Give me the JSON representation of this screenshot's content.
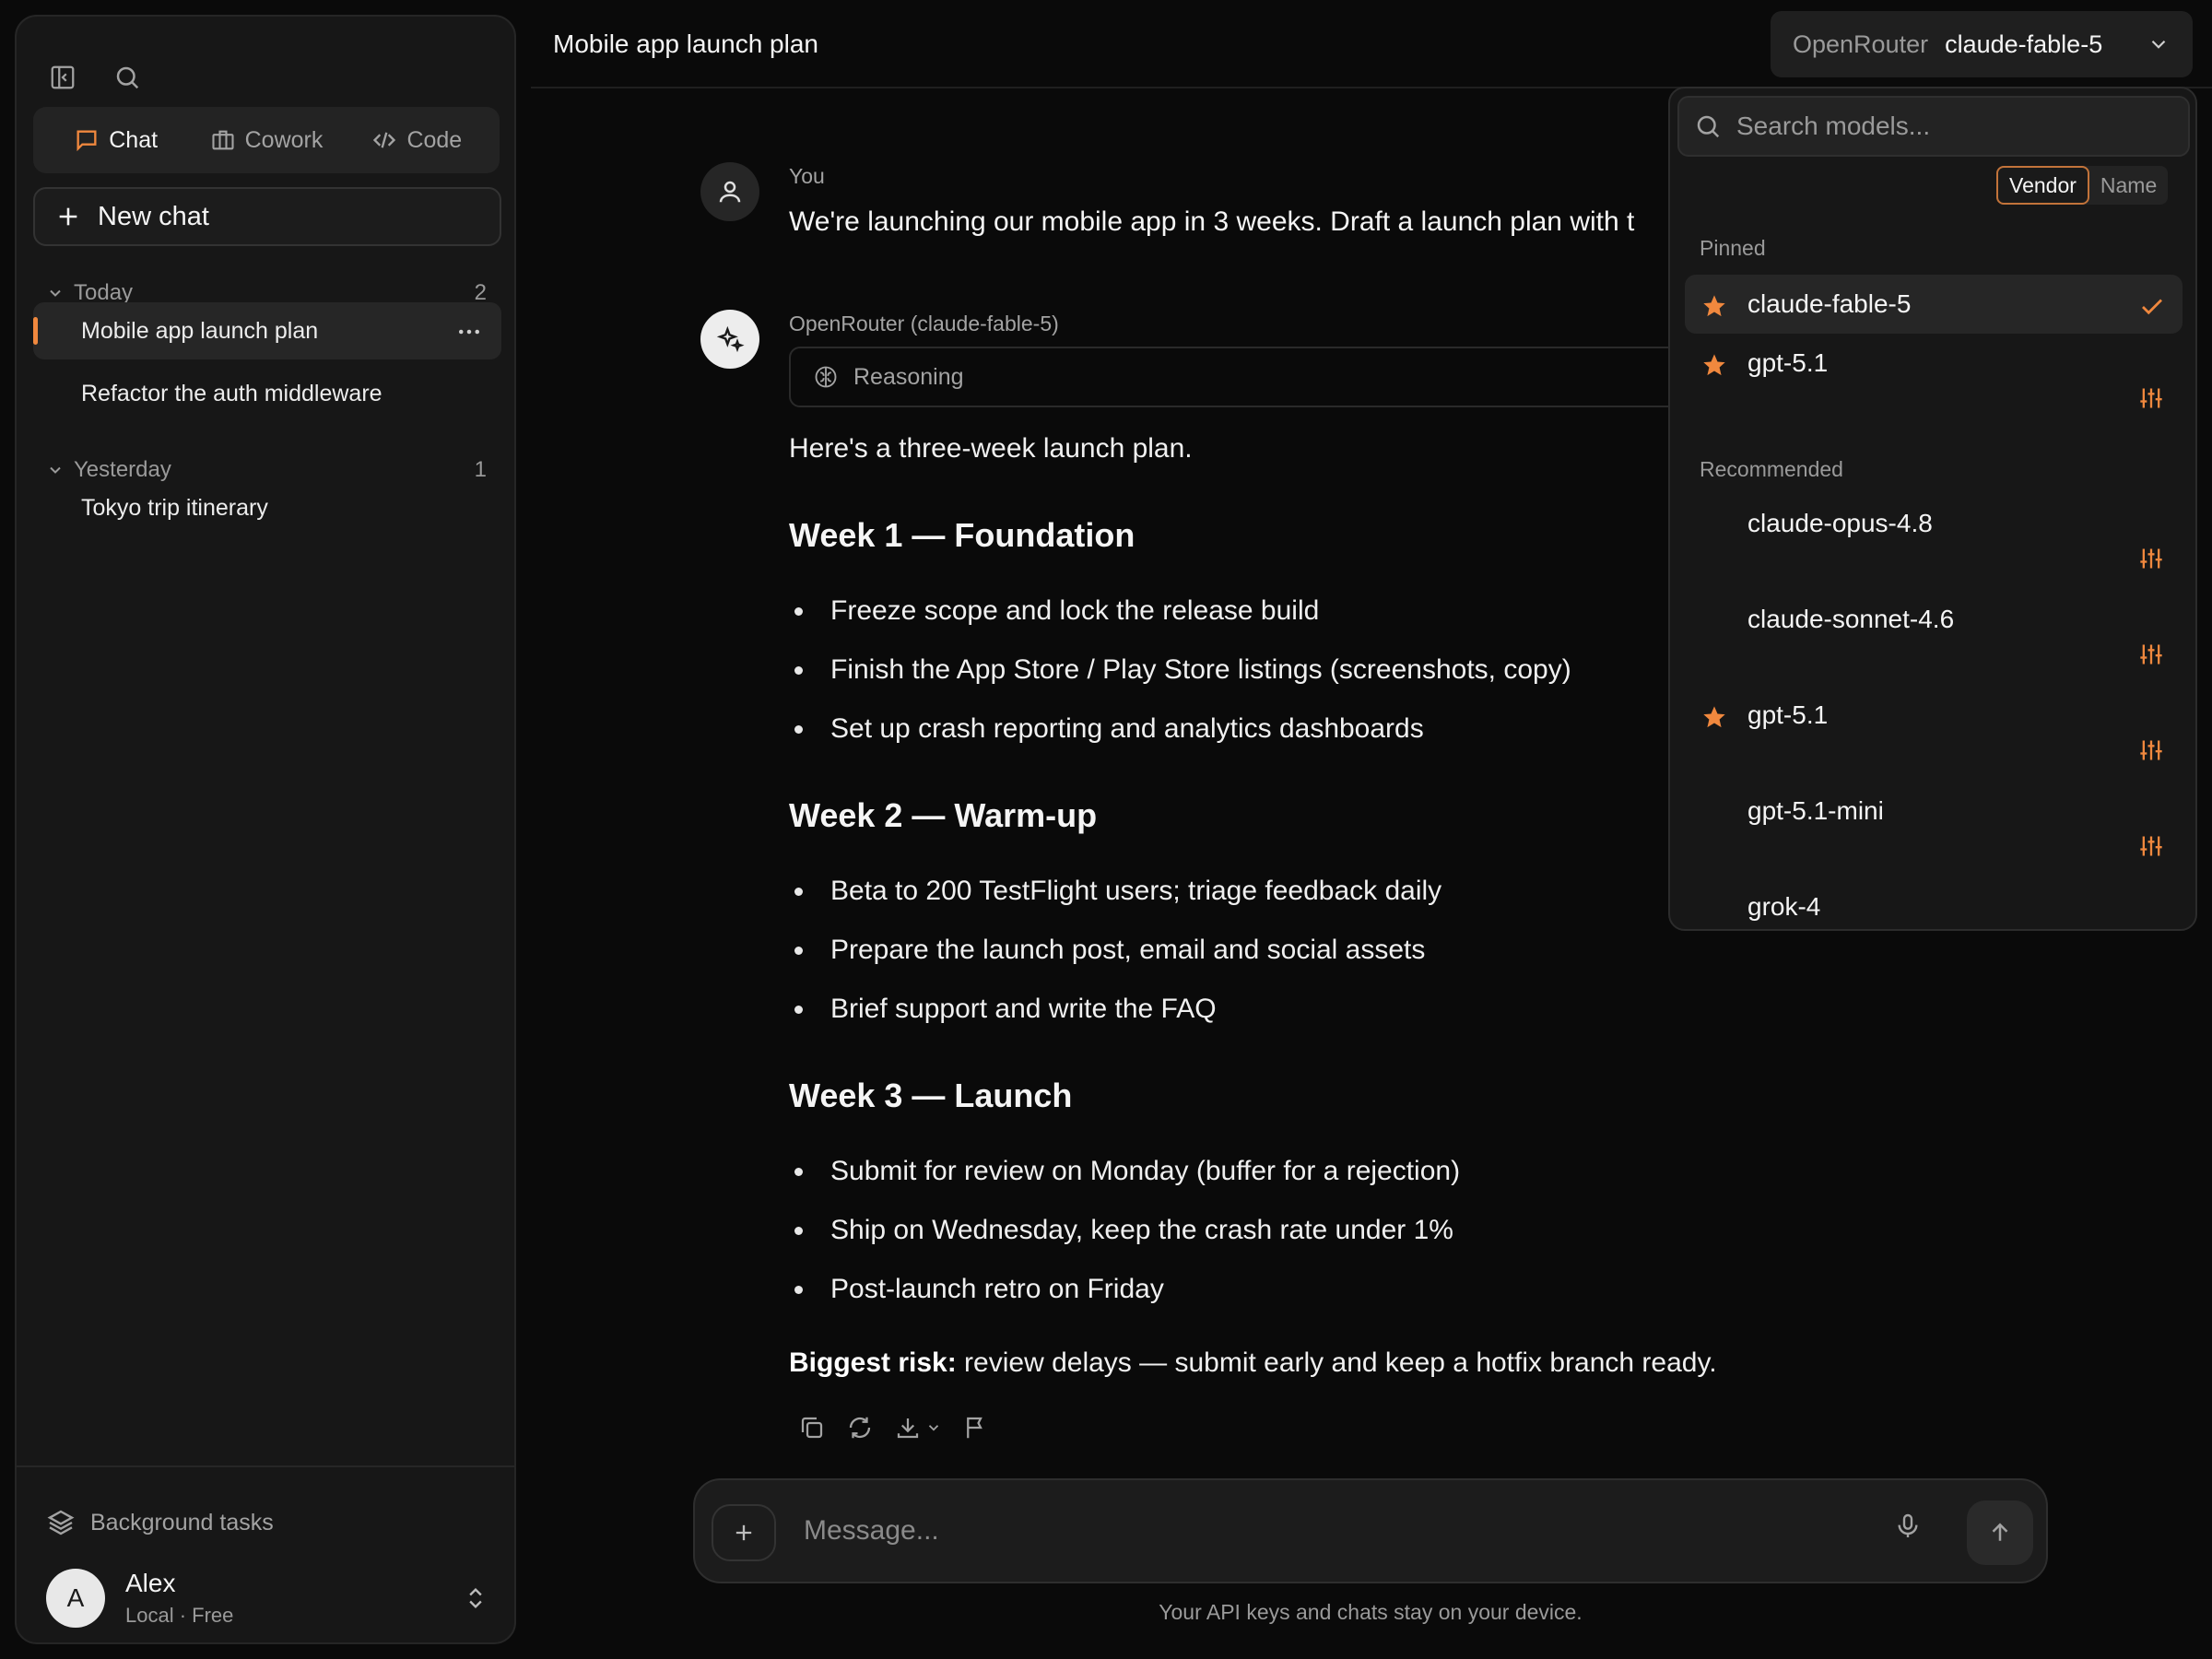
{
  "sidebar": {
    "modes": [
      "Chat",
      "Cowork",
      "Code"
    ],
    "new_chat": "New chat",
    "groups": [
      {
        "label": "Today",
        "count": "2",
        "items": [
          "Mobile app launch plan",
          "Refactor the auth middleware"
        ]
      },
      {
        "label": "Yesterday",
        "count": "1",
        "items": [
          "Tokyo trip itinerary"
        ]
      }
    ],
    "background_tasks": "Background tasks",
    "user": {
      "initial": "A",
      "name": "Alex",
      "plan": "Local · Free"
    }
  },
  "header": {
    "title": "Mobile app launch plan",
    "vendor": "OpenRouter",
    "model": "claude-fable-5"
  },
  "conversation": {
    "user_label": "You",
    "user_message": "We're launching our mobile app in 3 weeks. Draft a launch plan with t",
    "assistant_label": "OpenRouter (claude-fable-5)",
    "reasoning_label": "Reasoning",
    "intro": "Here's a three-week launch plan.",
    "weeks": [
      {
        "title": "Week 1 — Foundation",
        "items": [
          "Freeze scope and lock the release build",
          "Finish the App Store / Play Store listings (screenshots, copy)",
          "Set up crash reporting and analytics dashboards"
        ]
      },
      {
        "title": "Week 2 — Warm-up",
        "items": [
          "Beta to 200 TestFlight users; triage feedback daily",
          "Prepare the launch post, email and social assets",
          "Brief support and write the FAQ"
        ]
      },
      {
        "title": "Week 3 — Launch",
        "items": [
          "Submit for review on Monday (buffer for a rejection)",
          "Ship on Wednesday, keep the crash rate under 1%",
          "Post-launch retro on Friday"
        ]
      }
    ],
    "risk_label": "Biggest risk:",
    "risk_text": " review delays — submit early and keep a hotfix branch ready."
  },
  "composer": {
    "placeholder": "Message...",
    "footnote": "Your API keys and chats stay on your device."
  },
  "model_menu": {
    "search_placeholder": "Search models...",
    "sort_options": [
      "Vendor",
      "Name"
    ],
    "pinned_label": "Pinned",
    "pinned": [
      {
        "name": "claude-fable-5",
        "starred": true,
        "selected": true
      },
      {
        "name": "gpt-5.1",
        "starred": true,
        "selected": false
      }
    ],
    "recommended_label": "Recommended",
    "recommended": [
      {
        "name": "claude-opus-4.8",
        "starred": false
      },
      {
        "name": "claude-sonnet-4.6",
        "starred": false
      },
      {
        "name": "gpt-5.1",
        "starred": true
      },
      {
        "name": "gpt-5.1-mini",
        "starred": false
      },
      {
        "name": "grok-4",
        "starred": false
      }
    ]
  },
  "colors": {
    "accent": "#f0883e",
    "background": "#0a0a0a",
    "sidebar": "#171717"
  }
}
